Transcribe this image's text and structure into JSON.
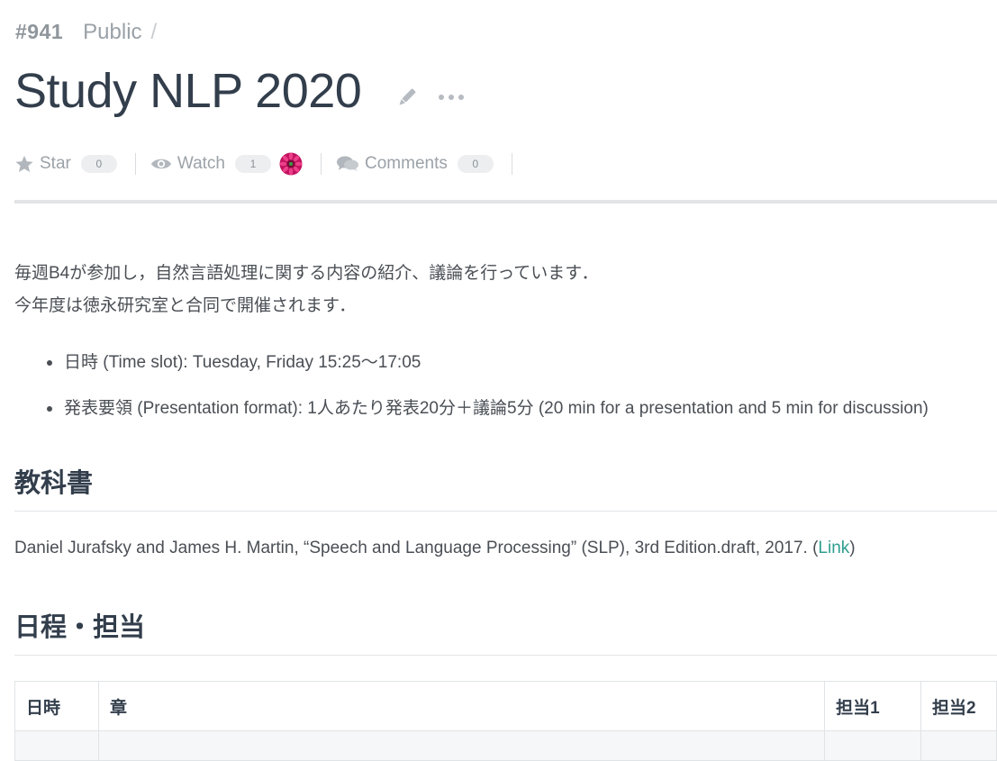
{
  "header": {
    "id": "#941",
    "visibility": "Public",
    "separator": "/",
    "title": "Study NLP 2020"
  },
  "actions": {
    "star": {
      "label": "Star",
      "count": "0"
    },
    "watch": {
      "label": "Watch",
      "count": "1"
    },
    "comments": {
      "label": "Comments",
      "count": "0"
    }
  },
  "content": {
    "intro_lines": [
      "毎週B4が参加し，自然言語処理に関する内容の紹介、議論を行っています．",
      "今年度は徳永研究室と合同で開催されます．"
    ],
    "bullets": [
      "日時 (Time slot): Tuesday, Friday 15:25〜17:05",
      "発表要領 (Presentation format): 1人あたり発表20分＋議論5分 (20 min for a presentation and 5 min for discussion)"
    ],
    "textbook_heading": "教科書",
    "textbook_text": "Daniel Jurafsky and James H. Martin, “Speech and Language Processing” (SLP), 3rd Edition.draft, 2017. (",
    "textbook_link": "Link",
    "textbook_close": ")",
    "schedule_heading": "日程・担当",
    "table_headers": [
      "日時",
      "章",
      "担当1",
      "担当2"
    ]
  },
  "colors": {
    "title": "#333e4c",
    "muted": "#9ba2a8",
    "link": "#2f9e8f",
    "rule": "#e2e4e6"
  },
  "icons": {
    "edit": "pencil-icon",
    "more": "more-dots-icon",
    "star": "star-icon",
    "watch": "eye-icon",
    "comments": "comments-icon",
    "avatar": "flower-avatar"
  }
}
